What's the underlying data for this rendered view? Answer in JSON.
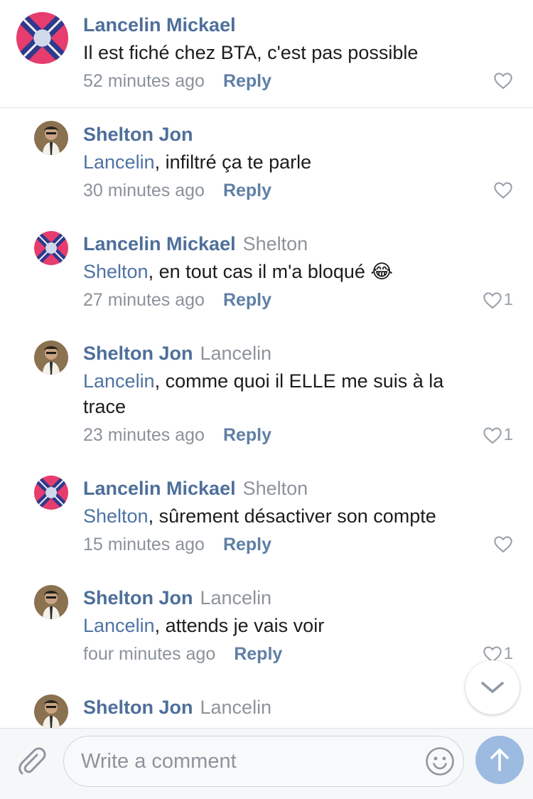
{
  "comments": [
    {
      "author": "Lancelin Mickael",
      "reply_to": "",
      "mention": "",
      "text": "Il est fiché chez BTA,  c'est pas possible",
      "time": "52 minutes ago",
      "reply_label": "Reply",
      "likes": ""
    },
    {
      "author": "Shelton Jon",
      "reply_to": "",
      "mention": "Lancelin",
      "text": ", infiltré ça te parle",
      "time": "30 minutes ago",
      "reply_label": "Reply",
      "likes": ""
    },
    {
      "author": "Lancelin Mickael",
      "reply_to": "Shelton",
      "mention": "Shelton",
      "text": ", en tout cas il m'a bloqué 😂",
      "time": "27 minutes ago",
      "reply_label": "Reply",
      "likes": "1"
    },
    {
      "author": "Shelton Jon",
      "reply_to": "Lancelin",
      "mention": "Lancelin",
      "text": ", comme quoi il ELLE me suis à la trace",
      "time": "23 minutes ago",
      "reply_label": "Reply",
      "likes": "1"
    },
    {
      "author": "Lancelin Mickael",
      "reply_to": "Shelton",
      "mention": "Shelton",
      "text": ", sûrement désactiver son compte",
      "time": "15 minutes ago",
      "reply_label": "Reply",
      "likes": ""
    },
    {
      "author": "Shelton Jon",
      "reply_to": "Lancelin",
      "mention": "Lancelin",
      "text": ", attends je vais voir",
      "time": "four minutes ago",
      "reply_label": "Reply",
      "likes": "1"
    },
    {
      "author": "Shelton Jon",
      "reply_to": "Lancelin",
      "mention": "",
      "text": "",
      "time": "",
      "reply_label": "",
      "likes": ""
    }
  ],
  "composer": {
    "placeholder": "Write a comment"
  },
  "icons": {
    "attach": "paperclip-icon",
    "emoji": "emoji-icon",
    "send": "arrow-up-icon",
    "scroll": "chevron-down-icon",
    "like": "heart-icon"
  },
  "colors": {
    "author": "#4e6f9b",
    "mention": "#4e73a3",
    "send_button": "#9dbbe1"
  }
}
